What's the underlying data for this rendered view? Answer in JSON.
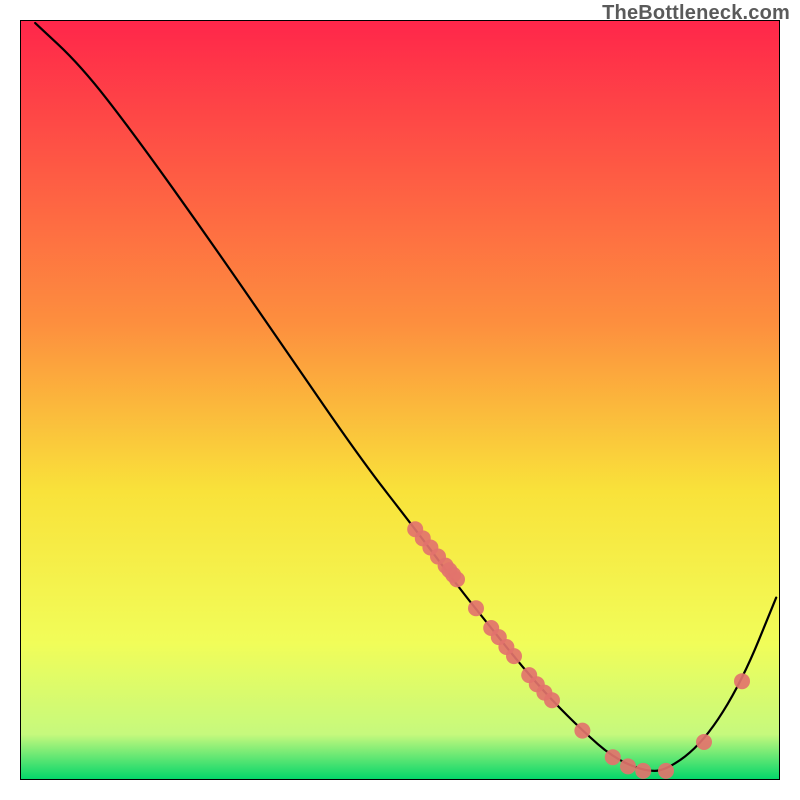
{
  "watermark": "TheBottleneck.com",
  "chart_data": {
    "type": "line",
    "title": "",
    "xlabel": "",
    "ylabel": "",
    "xlim": [
      0,
      100
    ],
    "ylim": [
      0,
      100
    ],
    "curve": {
      "x": [
        2,
        8,
        15,
        25,
        35,
        45,
        52,
        58,
        62,
        66,
        70,
        74,
        78,
        82,
        85,
        90,
        95,
        99.5
      ],
      "y": [
        99.6,
        94,
        85,
        71,
        56.5,
        42,
        33,
        25,
        20,
        15,
        10.5,
        6.5,
        3,
        1.2,
        1.2,
        5,
        13,
        24
      ]
    },
    "series": [
      {
        "name": "highlight-dots",
        "x": [
          52,
          53,
          54,
          55,
          56,
          56.5,
          57,
          57.5,
          60,
          62,
          63,
          64,
          65,
          67,
          68,
          69,
          70,
          74,
          78,
          80,
          82,
          85,
          90,
          95
        ],
        "y": [
          33,
          31.8,
          30.6,
          29.4,
          28.2,
          27.6,
          27,
          26.4,
          22.6,
          20,
          18.8,
          17.5,
          16.3,
          13.8,
          12.6,
          11.5,
          10.5,
          6.5,
          3,
          1.8,
          1.2,
          1.2,
          5,
          13
        ]
      }
    ],
    "colors": {
      "gradient_top": "#ff264a",
      "gradient_mid1": "#fd8f3e",
      "gradient_mid2": "#f9e23a",
      "gradient_mid3": "#f1fd59",
      "gradient_bot1": "#c6f97d",
      "gradient_bot2": "#00d56a",
      "curve": "#000000",
      "dots": "#e2736d",
      "frame": "#000000"
    }
  }
}
